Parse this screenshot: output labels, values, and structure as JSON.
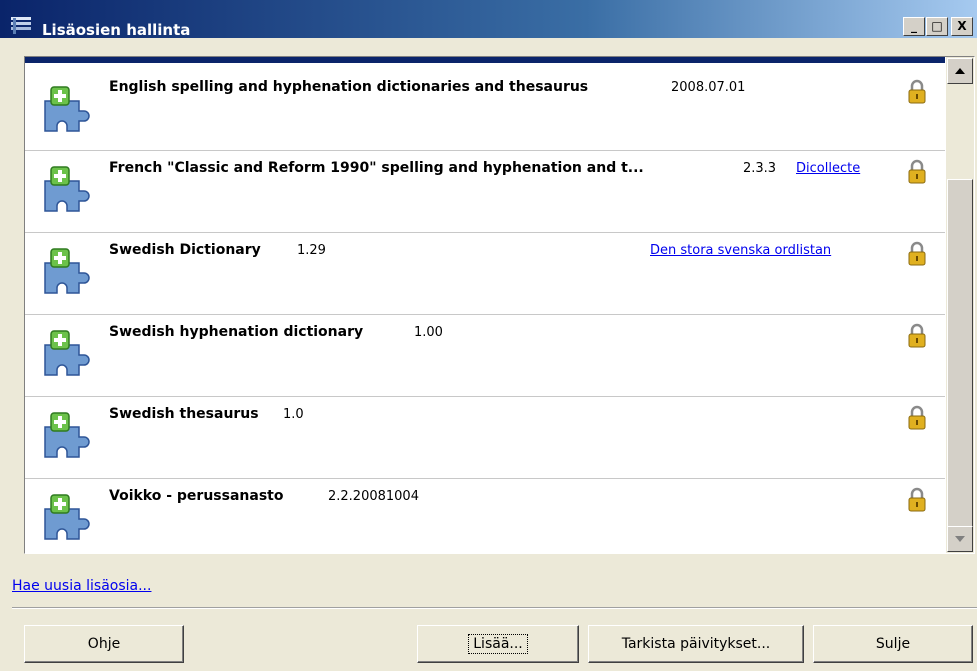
{
  "window": {
    "title": "Lisäosien hallinta",
    "controls": [
      "_",
      "□",
      "X"
    ]
  },
  "addons": [
    {
      "title": "English spelling and hyphenation dictionaries and thesaurus",
      "version": "2008.07.01",
      "link": ""
    },
    {
      "title": "French \"Classic and Reform 1990\" spelling and hyphenation and t...",
      "version": "2.3.3",
      "link": "Dicollecte"
    },
    {
      "title": "Swedish Dictionary",
      "version": "1.29",
      "link": "Den stora svenska ordlistan"
    },
    {
      "title": "Swedish hyphenation dictionary",
      "version": "1.00",
      "link": ""
    },
    {
      "title": "Swedish thesaurus",
      "version": "1.0",
      "link": ""
    },
    {
      "title": "Voikko - perussanasto",
      "version": "2.2.20081004",
      "link": ""
    }
  ],
  "footer": {
    "get_more_link": "Hae uusia lisäosia...",
    "help_button": "Ohje",
    "add_button": "Lisää...",
    "check_updates_button": "Tarkista päivitykset...",
    "close_button": "Sulje"
  },
  "colors": {
    "title_gradient_start": "#0a246a",
    "title_gradient_end": "#a6caf0",
    "link": "#0000ee",
    "dialog_bg": "#ece9d8",
    "addon_icon_green": "#6cc24a",
    "addon_icon_blue": "#6f9bd1",
    "lock_gold": "#e0b020"
  },
  "icons": {
    "title": "addon-manager-icon",
    "addon": "puzzle-plus-icon",
    "locked": "padlock-icon",
    "scroll_up": "arrow-up-icon",
    "scroll_down": "arrow-down-icon"
  },
  "list": {
    "selected_index": 0,
    "scroll_position": 0
  }
}
